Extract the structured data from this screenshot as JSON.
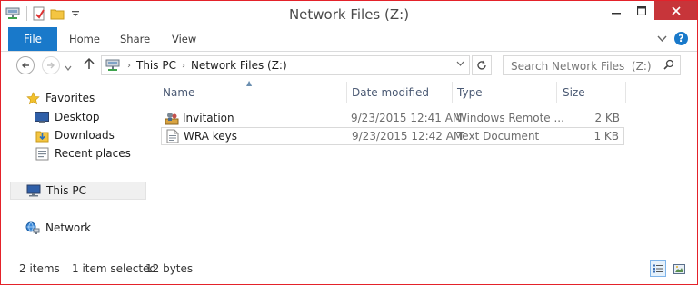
{
  "window": {
    "title": "Network Files  (Z:)"
  },
  "ribbon": {
    "file_tab": "File",
    "tabs": [
      "Home",
      "Share",
      "View"
    ]
  },
  "address": {
    "crumbs": [
      "This PC",
      "Network Files  (Z:)"
    ]
  },
  "search": {
    "placeholder": "Search Network Files  (Z:)"
  },
  "nav": {
    "favorites": "Favorites",
    "desktop": "Desktop",
    "downloads": "Downloads",
    "recent": "Recent places",
    "this_pc": "This PC",
    "network": "Network"
  },
  "columns": {
    "name": "Name",
    "date": "Date modified",
    "type": "Type",
    "size": "Size"
  },
  "files": [
    {
      "name": "Invitation",
      "date": "9/23/2015 12:41 AM",
      "type": "Windows Remote ...",
      "size": "2 KB",
      "icon": "remote-assistance-icon"
    },
    {
      "name": "WRA keys",
      "date": "9/23/2015 12:42 AM",
      "type": "Text Document",
      "size": "1 KB",
      "icon": "text-document-icon"
    }
  ],
  "status": {
    "items": "2 items",
    "selected": "1 item selected",
    "bytes": "12 bytes"
  },
  "colors": {
    "accent": "#1979ca",
    "close": "#c7353a",
    "border": "#e4222a"
  }
}
